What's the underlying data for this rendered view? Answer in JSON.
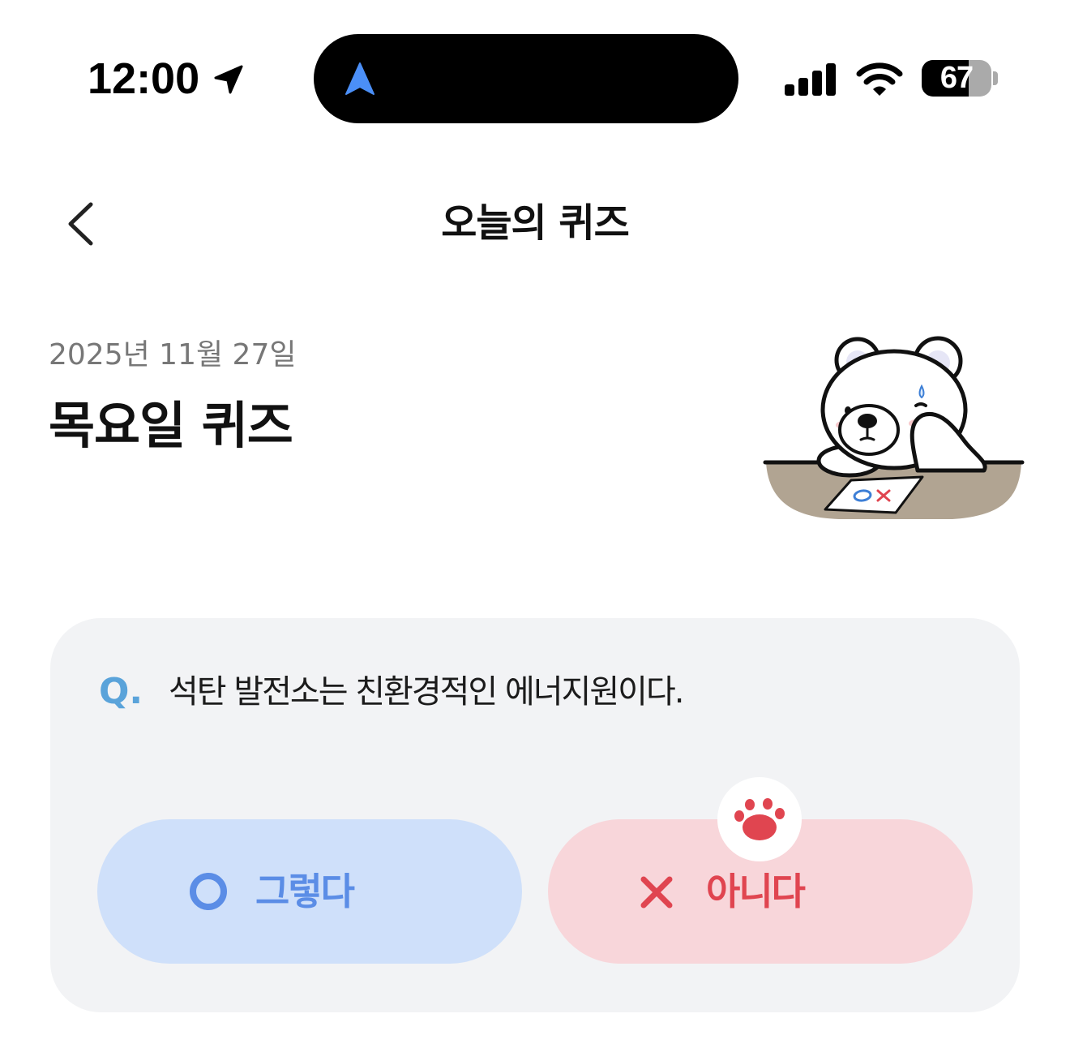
{
  "status_bar": {
    "time": "12:00",
    "location_icon": "location-arrow-icon",
    "dynamic_island_icon": "navigation-arrow-icon",
    "signal_icon": "cellular-signal-icon",
    "wifi_icon": "wifi-icon",
    "battery_percent": "67",
    "battery_level": 0.67
  },
  "nav": {
    "title": "오늘의 퀴즈",
    "back_icon": "chevron-left-icon"
  },
  "header": {
    "date": "2025년 11월 27일",
    "title": "목요일 퀴즈",
    "illustration": "bear-quiz-illustration"
  },
  "quiz": {
    "question_prefix": "Q.",
    "question": "석탄 발전소는 친환경적인 에너지원이다.",
    "options": [
      {
        "label": "그렇다",
        "icon": "circle-o-icon",
        "selected": false
      },
      {
        "label": "아니다",
        "icon": "x-icon",
        "selected": true
      }
    ],
    "selection_icon": "paw-icon"
  },
  "colors": {
    "accent_blue": "#5b8de6",
    "accent_red": "#e04550",
    "card_bg": "#f2f3f5",
    "true_button_bg": "#cfe0fa",
    "false_button_bg": "#f8d6da",
    "question_prefix": "#5aa3da"
  }
}
